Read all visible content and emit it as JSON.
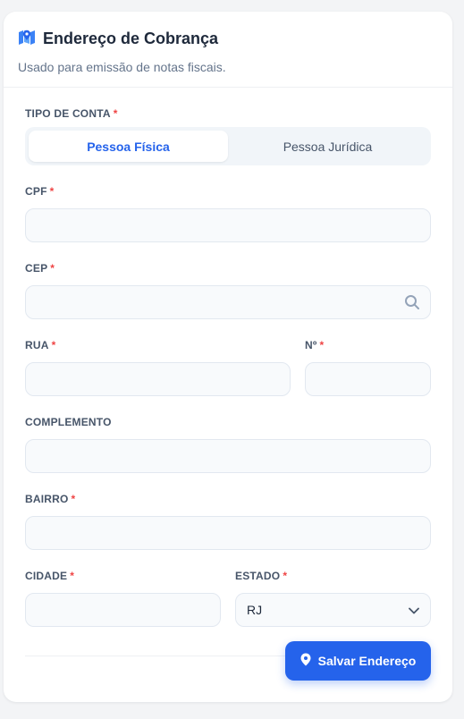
{
  "header": {
    "title": "Endereço de Cobrança",
    "subtitle": "Usado para emissão de notas fiscais.",
    "icon": "map-icon"
  },
  "required_mark": "*",
  "account_type": {
    "label": "TIPO DE CONTA",
    "options": [
      "Pessoa Física",
      "Pessoa Jurídica"
    ],
    "selected": "Pessoa Física"
  },
  "fields": {
    "cpf": {
      "label": "CPF",
      "value": ""
    },
    "cep": {
      "label": "CEP",
      "value": ""
    },
    "rua": {
      "label": "RUA",
      "value": ""
    },
    "numero": {
      "label": "Nº",
      "value": ""
    },
    "complemento": {
      "label": "COMPLEMENTO",
      "value": ""
    },
    "bairro": {
      "label": "BAIRRO",
      "value": ""
    },
    "cidade": {
      "label": "CIDADE",
      "value": ""
    },
    "estado": {
      "label": "ESTADO",
      "value": "RJ"
    }
  },
  "save_button": {
    "label": "Salvar Endereço",
    "icon": "map-pin-icon"
  },
  "colors": {
    "accent": "#2563eb",
    "required": "#ef4444"
  }
}
